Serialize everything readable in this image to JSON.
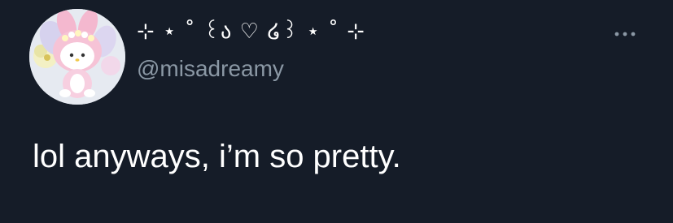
{
  "tweet": {
    "display_name": "⊹ ⋆ ˚ ꒰ა ♡ ໒꒱ ⋆ ˚ ⊹",
    "handle": "@misadreamy",
    "text": "lol anyways, i’m so pretty.",
    "more_icon": "more-horizontal-icon"
  },
  "colors": {
    "background": "#151c28",
    "text_primary": "#ffffff",
    "text_secondary": "#8b98a5"
  }
}
